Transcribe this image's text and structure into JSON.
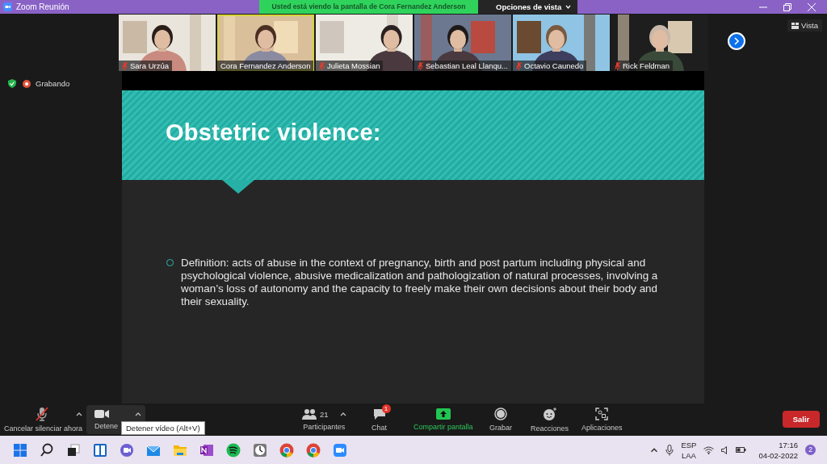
{
  "window": {
    "title": "Zoom Reunión"
  },
  "share_banner": {
    "text": "Usted está viendo la pantalla de Cora Fernandez Anderson"
  },
  "view_options": {
    "label": "Opciones de vista"
  },
  "participants": [
    {
      "name": "Sara Urzúa",
      "muted": true,
      "speaking": false
    },
    {
      "name": "Cora Fernandez Anderson",
      "muted": false,
      "speaking": true
    },
    {
      "name": "Julieta Mossian",
      "muted": true,
      "speaking": false
    },
    {
      "name": "Sebastian Leal Llanqu...",
      "muted": true,
      "speaking": false
    },
    {
      "name": "Octavio Caunedo",
      "muted": true,
      "speaking": false
    },
    {
      "name": "Rick Feldman",
      "muted": true,
      "speaking": false
    }
  ],
  "view_button": {
    "label": "Vista"
  },
  "recording": {
    "label": "Grabando"
  },
  "slide": {
    "title": "Obstetric violence:",
    "bullets": [
      "Definition: acts of abuse in the context of pregnancy, birth and post partum including physical and psychological violence, abusive medicalization and pathologization of natural processes, involving a woman’s loss of autonomy and the capacity to freely make their own decisions about their body and their sexuality."
    ]
  },
  "toolbar": {
    "items": [
      {
        "kind": "mic",
        "label": "Cancelar silenciar ahora",
        "muted": true
      },
      {
        "kind": "video",
        "label": "Detene"
      },
      {
        "kind": "participants",
        "label": "Participantes",
        "count": "21"
      },
      {
        "kind": "chat",
        "label": "Chat",
        "badge": "1"
      },
      {
        "kind": "share",
        "label": "Compartir pantalla"
      },
      {
        "kind": "record",
        "label": "Grabar"
      },
      {
        "kind": "reactions",
        "label": "Reacciones"
      },
      {
        "kind": "apps",
        "label": "Aplicaciones"
      }
    ],
    "tooltip": "Detener vídeo (Alt+V)",
    "leave": "Salir"
  },
  "taskbar": {
    "language": [
      "ESP",
      "LAA"
    ],
    "time": "17:16",
    "date": "04-02-2022",
    "notifications": "2"
  }
}
